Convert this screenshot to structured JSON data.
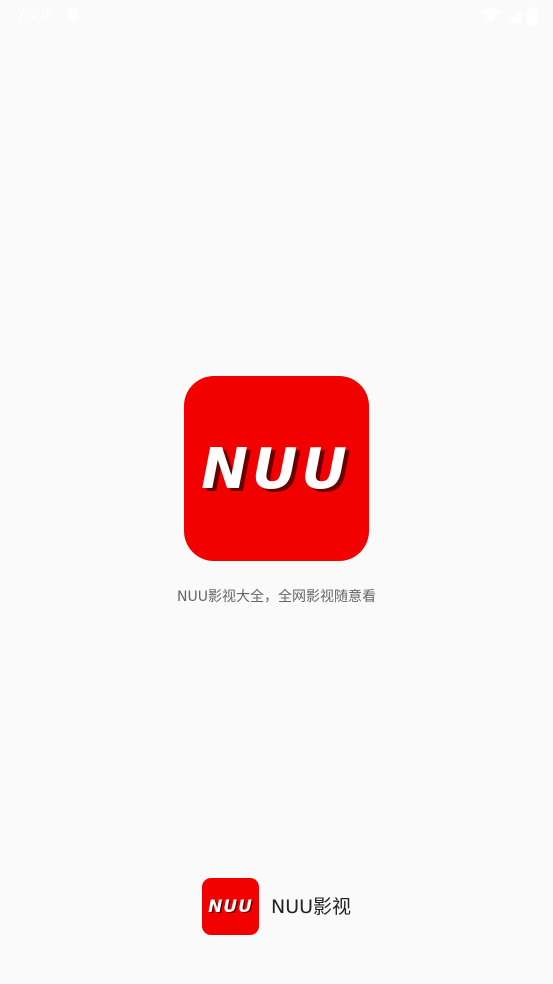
{
  "status_bar": {
    "time": "2:28",
    "icons": [
      "notification-icon",
      "wifi-icon",
      "signal-icon",
      "battery-icon"
    ]
  },
  "splash": {
    "logo_text": "NUU",
    "slogan": "NUU影视大全，全网影视随意看"
  },
  "footer": {
    "logo_text": "NUU",
    "app_name": "NUU影视"
  },
  "colors": {
    "background": "#fafafa",
    "brand_red": "#f20000",
    "logo_text": "#ffffff",
    "slogan_text": "#666666",
    "app_name_text": "#222222"
  }
}
